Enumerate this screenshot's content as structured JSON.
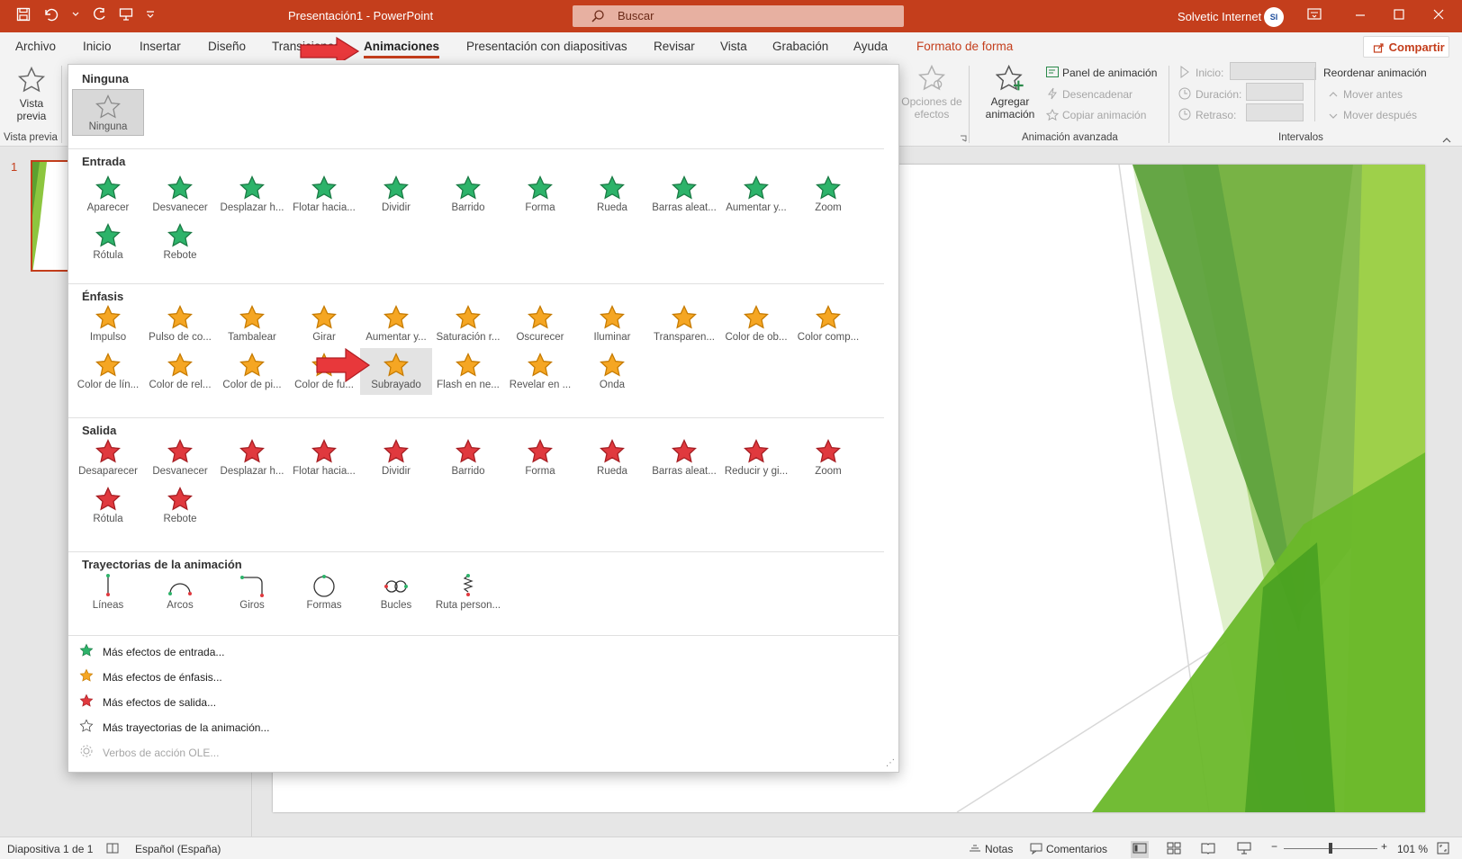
{
  "window": {
    "title": "Presentación1 - PowerPoint",
    "search_placeholder": "Buscar",
    "user_name": "Solvetic Internet",
    "avatar_text": "SI"
  },
  "tabs": [
    {
      "label": "Archivo"
    },
    {
      "label": "Inicio"
    },
    {
      "label": "Insertar"
    },
    {
      "label": "Diseño"
    },
    {
      "label": "Transiciones"
    },
    {
      "label": "Animaciones",
      "active": true
    },
    {
      "label": "Presentación con diapositivas"
    },
    {
      "label": "Revisar"
    },
    {
      "label": "Vista"
    },
    {
      "label": "Grabación"
    },
    {
      "label": "Ayuda"
    },
    {
      "label": "Formato de forma",
      "contextual": true
    }
  ],
  "share_label": "Compartir",
  "ribbon": {
    "preview": {
      "label_1": "Vista",
      "label_2": "previa",
      "group": "Vista previa"
    },
    "effect_options": {
      "label_1": "Opciones de",
      "label_2": "efectos"
    },
    "add_animation": {
      "label_1": "Agregar",
      "label_2": "animación"
    },
    "animation_pane": "Panel de animación",
    "trigger": "Desencadenar",
    "copy_animation": "Copiar animación",
    "advanced_group": "Animación avanzada",
    "start": "Inicio:",
    "duration": "Duración:",
    "delay": "Retraso:",
    "reorder": "Reordenar animación",
    "move_earlier": "Mover antes",
    "move_later": "Mover después",
    "timing_group": "Intervalos"
  },
  "thumbnail_number": "1",
  "gallery": {
    "none": {
      "title": "Ninguna",
      "items": [
        "Ninguna"
      ]
    },
    "entrance": {
      "title": "Entrada",
      "items": [
        "Aparecer",
        "Desvanecer",
        "Desplazar h...",
        "Flotar hacia...",
        "Dividir",
        "Barrido",
        "Forma",
        "Rueda",
        "Barras aleat...",
        "Aumentar y...",
        "Zoom",
        "Rótula",
        "Rebote"
      ]
    },
    "emphasis": {
      "title": "Énfasis",
      "items": [
        "Impulso",
        "Pulso de co...",
        "Tambalear",
        "Girar",
        "Aumentar y...",
        "Saturación r...",
        "Oscurecer",
        "Iluminar",
        "Transparen...",
        "Color de ob...",
        "Color comp...",
        "Color de lín...",
        "Color de rel...",
        "Color de pi...",
        "Color de fu...",
        "Subrayado",
        "Flash en ne...",
        "Revelar en ...",
        "Onda"
      ]
    },
    "exit": {
      "title": "Salida",
      "items": [
        "Desaparecer",
        "Desvanecer",
        "Desplazar h...",
        "Flotar hacia...",
        "Dividir",
        "Barrido",
        "Forma",
        "Rueda",
        "Barras aleat...",
        "Reducir y gi...",
        "Zoom",
        "Rótula",
        "Rebote"
      ]
    },
    "paths": {
      "title": "Trayectorias de la animación",
      "items": [
        "Líneas",
        "Arcos",
        "Giros",
        "Formas",
        "Bucles",
        "Ruta person..."
      ]
    },
    "more": [
      "Más efectos de entrada...",
      "Más efectos de énfasis...",
      "Más efectos de salida...",
      "Más trayectorias de la animación...",
      "Verbos de acción OLE..."
    ]
  },
  "status": {
    "slide": "Diapositiva 1 de 1",
    "language": "Español (España)",
    "notes": "Notas",
    "comments": "Comentarios",
    "zoom": "101 %"
  },
  "colors": {
    "accent": "#c43e1c",
    "entrance": "#2db36a",
    "emphasis": "#f5a623",
    "exit": "#e0393e"
  }
}
